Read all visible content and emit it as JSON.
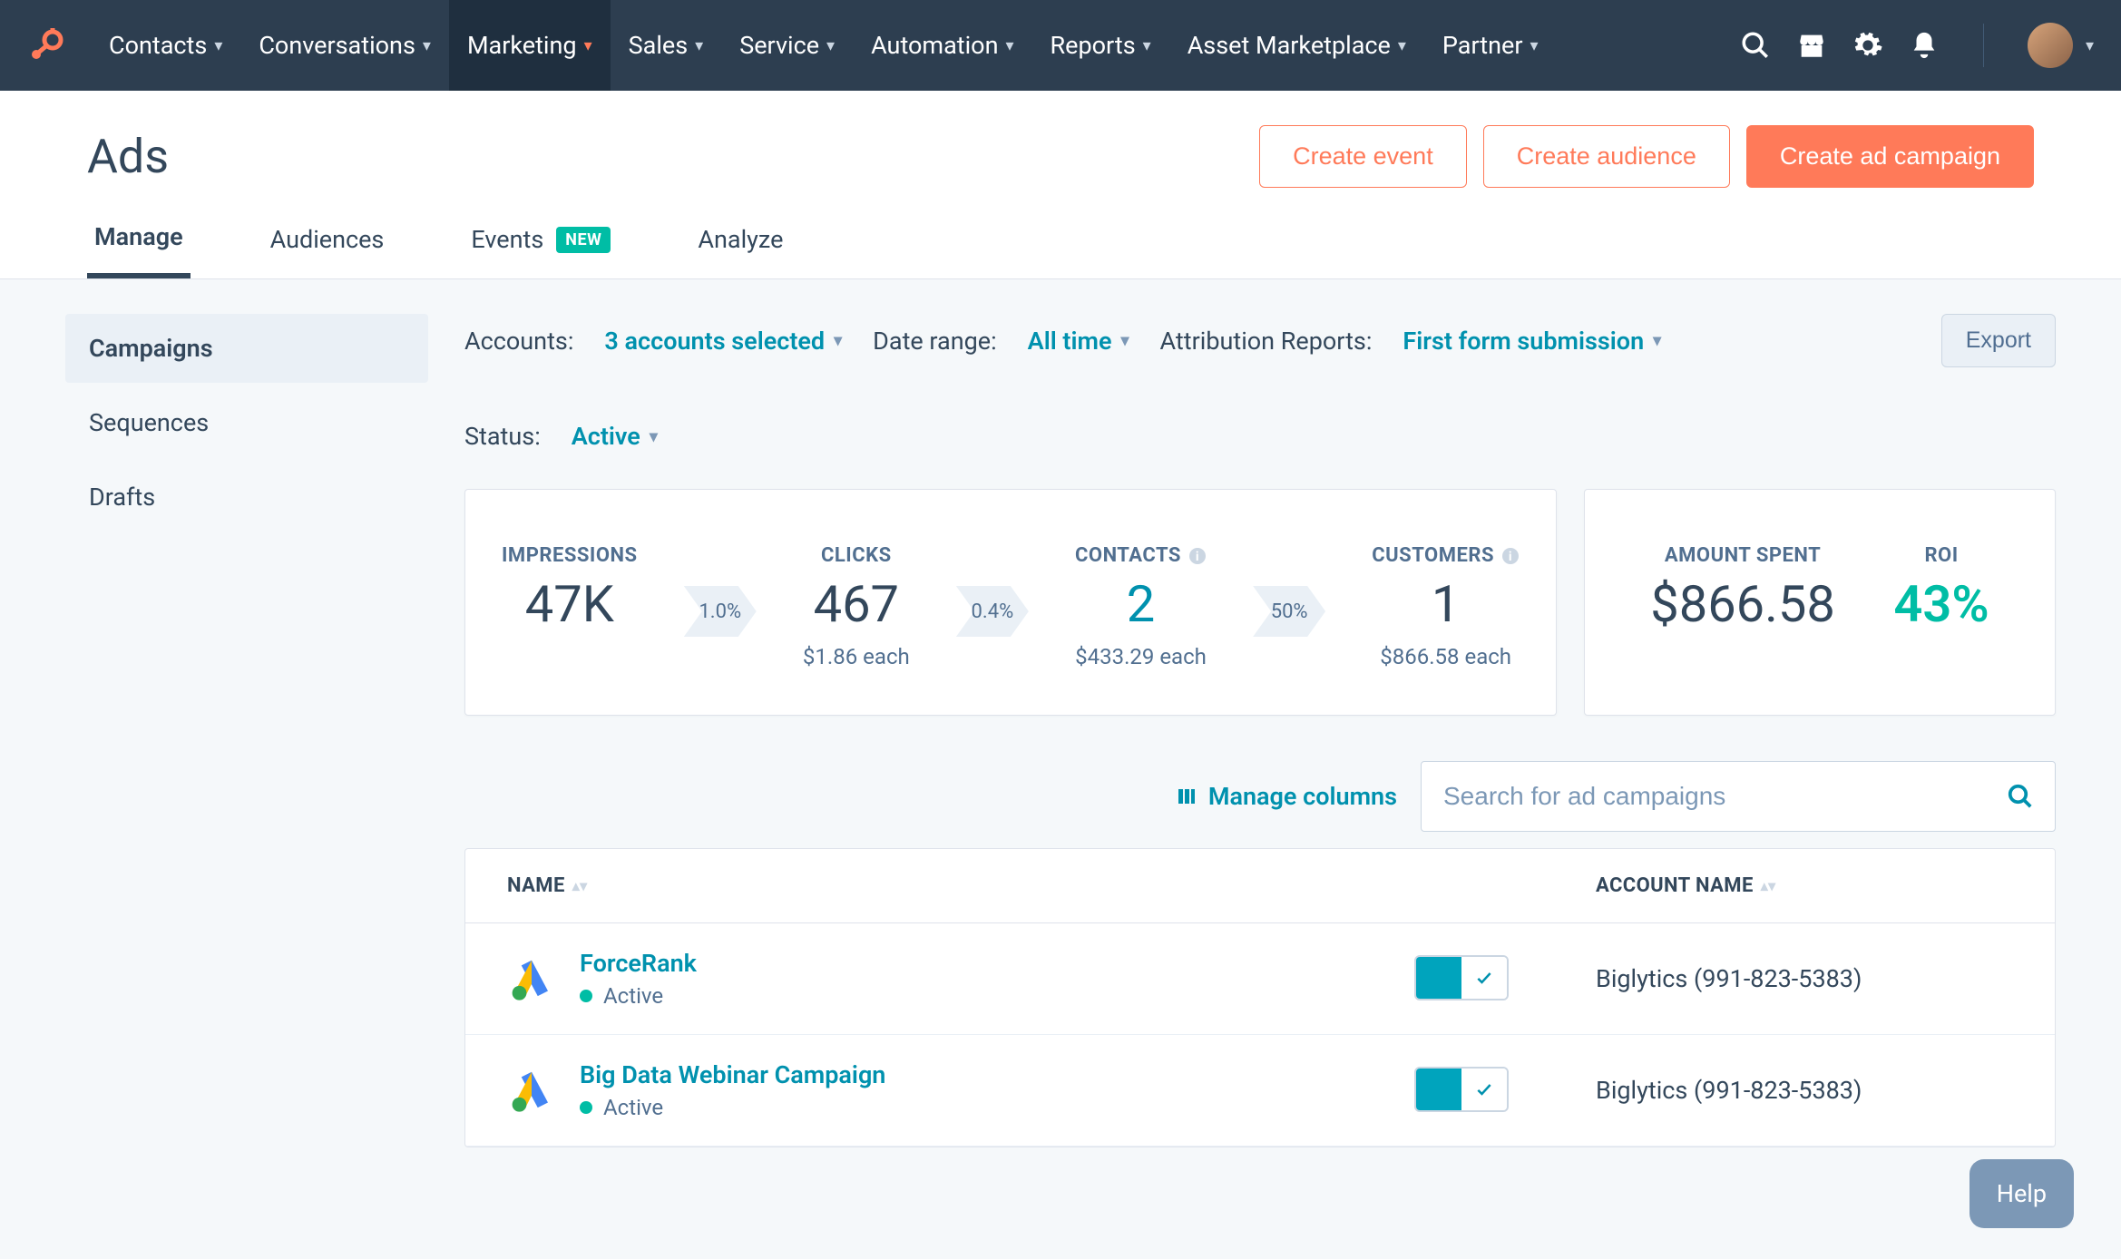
{
  "nav": {
    "items": [
      "Contacts",
      "Conversations",
      "Marketing",
      "Sales",
      "Service",
      "Automation",
      "Reports",
      "Asset Marketplace",
      "Partner"
    ],
    "active_index": 2
  },
  "page": {
    "title": "Ads"
  },
  "actions": {
    "create_event": "Create event",
    "create_audience": "Create audience",
    "create_campaign": "Create ad campaign"
  },
  "tabs": {
    "items": [
      "Manage",
      "Audiences",
      "Events",
      "Analyze"
    ],
    "active_index": 0,
    "new_badge": "NEW"
  },
  "sidebar": {
    "items": [
      "Campaigns",
      "Sequences",
      "Drafts"
    ],
    "active_index": 0
  },
  "filters": {
    "accounts_label": "Accounts:",
    "accounts_value": "3 accounts selected",
    "date_label": "Date range:",
    "date_value": "All time",
    "attr_label": "Attribution Reports:",
    "attr_value": "First form submission",
    "status_label": "Status:",
    "status_value": "Active",
    "export": "Export"
  },
  "metrics": {
    "impressions": {
      "label": "IMPRESSIONS",
      "value": "47K"
    },
    "clicks": {
      "label": "CLICKS",
      "value": "467",
      "sub": "$1.86 each"
    },
    "contacts": {
      "label": "CONTACTS",
      "value": "2",
      "sub": "$433.29 each"
    },
    "customers": {
      "label": "CUSTOMERS",
      "value": "1",
      "sub": "$866.58 each"
    },
    "rate1": "1.0%",
    "rate2": "0.4%",
    "rate3": "50%",
    "spent": {
      "label": "AMOUNT SPENT",
      "value": "$866.58"
    },
    "roi": {
      "label": "ROI",
      "value": "43%"
    }
  },
  "toolbar": {
    "manage_columns": "Manage columns",
    "search_placeholder": "Search for ad campaigns"
  },
  "table": {
    "headers": {
      "name": "NAME",
      "account": "ACCOUNT NAME"
    },
    "rows": [
      {
        "name": "ForceRank",
        "status": "Active",
        "account": "Biglytics (991-823-5383)"
      },
      {
        "name": "Big Data Webinar Campaign",
        "status": "Active",
        "account": "Biglytics (991-823-5383)"
      }
    ]
  },
  "help": "Help"
}
